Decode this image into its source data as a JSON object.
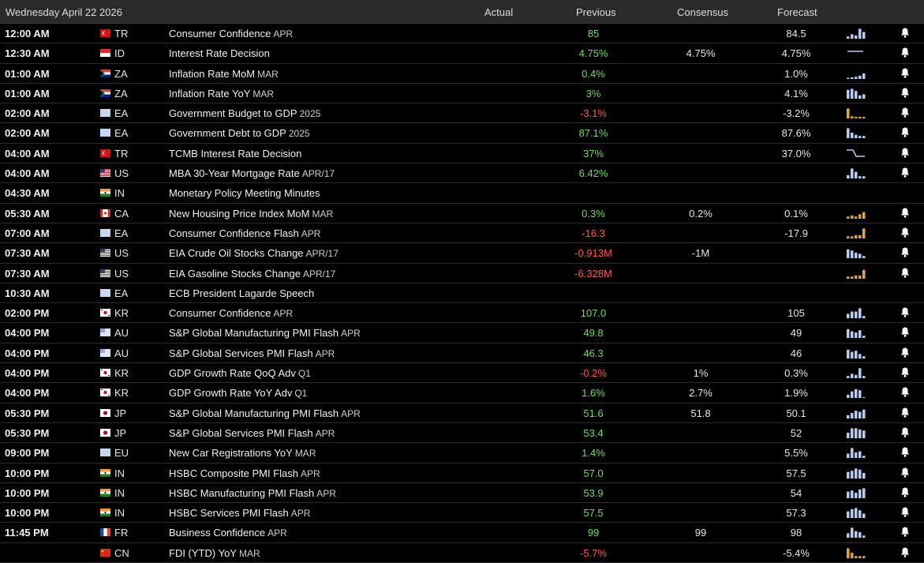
{
  "header": {
    "date": "Wednesday April 22 2026",
    "actual": "Actual",
    "previous": "Previous",
    "consensus": "Consensus",
    "forecast": "Forecast"
  },
  "colors": {
    "positive": "#6fdc5e",
    "negative": "#ff5a4f",
    "spark_blue": "#b7cdf0",
    "spark_gold": "#e5a934"
  },
  "rows": [
    {
      "time": "12:00 AM",
      "country": "TR",
      "flag": "tr",
      "event": "Consumer Confidence",
      "ref": "APR",
      "previous": "85",
      "prev_sign": "pos",
      "consensus": "",
      "forecast": "84.5",
      "spark": "bars-blue",
      "bars": [
        0.2,
        0.4,
        0.3,
        0.9,
        0.6
      ],
      "bell": true
    },
    {
      "time": "12:30 AM",
      "country": "ID",
      "flag": "id",
      "event": "Interest Rate Decision",
      "ref": "",
      "previous": "4.75%",
      "prev_sign": "pos",
      "consensus": "4.75%",
      "forecast": "4.75%",
      "spark": "flat",
      "bars": [],
      "bell": true
    },
    {
      "time": "01:00 AM",
      "country": "ZA",
      "flag": "za",
      "event": "Inflation Rate MoM",
      "ref": "MAR",
      "previous": "0.4%",
      "prev_sign": "pos",
      "consensus": "",
      "forecast": "1.0%",
      "spark": "bars-blue",
      "bars": [
        0.1,
        0.15,
        0.2,
        0.3,
        0.5
      ],
      "bell": true
    },
    {
      "time": "01:00 AM",
      "country": "ZA",
      "flag": "za",
      "event": "Inflation Rate YoY",
      "ref": "MAR",
      "previous": "3%",
      "prev_sign": "pos",
      "consensus": "",
      "forecast": "4.1%",
      "spark": "bars-blue",
      "bars": [
        0.8,
        0.9,
        0.7,
        0.3,
        0.4
      ],
      "bell": true
    },
    {
      "time": "02:00 AM",
      "country": "EA",
      "flag": "eu",
      "event": "Government Budget to GDP",
      "ref": "2025",
      "previous": "-3.1%",
      "prev_sign": "neg",
      "consensus": "",
      "forecast": "-3.2%",
      "spark": "bars-gold",
      "bars": [
        0.9,
        0.2,
        0.15,
        0.15,
        0.15
      ],
      "bell": true
    },
    {
      "time": "02:00 AM",
      "country": "EA",
      "flag": "eu",
      "event": "Government Debt to GDP",
      "ref": "2025",
      "previous": "87.1%",
      "prev_sign": "pos",
      "consensus": "",
      "forecast": "87.6%",
      "spark": "bars-blue",
      "bars": [
        0.9,
        0.5,
        0.3,
        0.2,
        0.2
      ],
      "bell": true
    },
    {
      "time": "04:00 AM",
      "country": "TR",
      "flag": "tr",
      "event": "TCMB Interest Rate Decision",
      "ref": "",
      "previous": "37%",
      "prev_sign": "pos",
      "consensus": "",
      "forecast": "37.0%",
      "spark": "step",
      "bars": [],
      "bell": true
    },
    {
      "time": "04:00 AM",
      "country": "US",
      "flag": "us",
      "event": "MBA 30-Year Mortgage Rate",
      "ref": "APR/17",
      "previous": "6.42%",
      "prev_sign": "pos",
      "consensus": "",
      "forecast": "",
      "spark": "bars-blue",
      "bars": [
        0.3,
        0.9,
        0.6,
        0.2,
        0.2
      ],
      "bell": true
    },
    {
      "time": "04:30 AM",
      "country": "IN",
      "flag": "in",
      "event": "Monetary Policy Meeting Minutes",
      "ref": "",
      "previous": "",
      "prev_sign": "pos",
      "consensus": "",
      "forecast": "",
      "spark": "none",
      "bars": [],
      "bell": false
    },
    {
      "time": "05:30 AM",
      "country": "CA",
      "flag": "ca",
      "event": "New Housing Price Index MoM",
      "ref": "MAR",
      "previous": "0.3%",
      "prev_sign": "pos",
      "consensus": "0.2%",
      "forecast": "0.1%",
      "spark": "bars-gold",
      "bars": [
        0.2,
        0.3,
        0.2,
        0.4,
        0.6
      ],
      "bell": true
    },
    {
      "time": "07:00 AM",
      "country": "EA",
      "flag": "eu",
      "event": "Consumer Confidence Flash",
      "ref": "APR",
      "previous": "-16.3",
      "prev_sign": "neg",
      "consensus": "",
      "forecast": "-17.9",
      "spark": "bars-gold",
      "bars": [
        0.2,
        0.2,
        0.3,
        0.3,
        0.9
      ],
      "bell": true
    },
    {
      "time": "07:30 AM",
      "country": "US",
      "flag": "us",
      "event": "EIA Crude Oil Stocks Change",
      "ref": "APR/17",
      "previous": "-0.913M",
      "prev_sign": "neg",
      "consensus": "-1M",
      "forecast": "",
      "spark": "bars-blue",
      "bars": [
        0.8,
        0.7,
        0.5,
        0.4,
        0.2
      ],
      "bell": true
    },
    {
      "time": "07:30 AM",
      "country": "US",
      "flag": "us",
      "event": "EIA Gasoline Stocks Change",
      "ref": "APR/17",
      "previous": "-6.328M",
      "prev_sign": "neg",
      "consensus": "",
      "forecast": "",
      "spark": "bars-gold",
      "bars": [
        0.2,
        0.2,
        0.3,
        0.3,
        0.8
      ],
      "bell": true
    },
    {
      "time": "10:30 AM",
      "country": "EA",
      "flag": "eu",
      "event": "ECB President Lagarde Speech",
      "ref": "",
      "previous": "",
      "prev_sign": "pos",
      "consensus": "",
      "forecast": "",
      "spark": "none",
      "bars": [],
      "bell": false
    },
    {
      "time": "02:00 PM",
      "country": "KR",
      "flag": "kr",
      "event": "Consumer Confidence",
      "ref": "APR",
      "previous": "107.0",
      "prev_sign": "pos",
      "consensus": "",
      "forecast": "105",
      "spark": "bars-blue",
      "bars": [
        0.4,
        0.6,
        0.6,
        0.9,
        0.2
      ],
      "bell": true
    },
    {
      "time": "04:00 PM",
      "country": "AU",
      "flag": "au",
      "event": "S&P Global Manufacturing PMI Flash",
      "ref": "APR",
      "previous": "49.8",
      "prev_sign": "pos",
      "consensus": "",
      "forecast": "49",
      "spark": "bars-blue",
      "bars": [
        0.8,
        0.6,
        0.5,
        0.7,
        0.2
      ],
      "bell": true
    },
    {
      "time": "04:00 PM",
      "country": "AU",
      "flag": "au",
      "event": "S&P Global Services PMI Flash",
      "ref": "APR",
      "previous": "46.3",
      "prev_sign": "pos",
      "consensus": "",
      "forecast": "46",
      "spark": "bars-blue",
      "bars": [
        0.8,
        0.6,
        0.7,
        0.4,
        0.2
      ],
      "bell": true
    },
    {
      "time": "04:00 PM",
      "country": "KR",
      "flag": "kr",
      "event": "GDP Growth Rate QoQ Adv",
      "ref": "Q1",
      "previous": "-0.2%",
      "prev_sign": "neg",
      "consensus": "1%",
      "forecast": "0.3%",
      "spark": "bars-blue",
      "bars": [
        0.2,
        0.4,
        0.3,
        0.9,
        0.2
      ],
      "bell": true
    },
    {
      "time": "04:00 PM",
      "country": "KR",
      "flag": "kr",
      "event": "GDP Growth Rate YoY Adv",
      "ref": "Q1",
      "previous": "1.6%",
      "prev_sign": "pos",
      "consensus": "2.7%",
      "forecast": "1.9%",
      "spark": "bars-blue",
      "bars": [
        0.3,
        0.6,
        0.8,
        0.7,
        0.0
      ],
      "bell": true
    },
    {
      "time": "05:30 PM",
      "country": "JP",
      "flag": "jp",
      "event": "S&P Global Manufacturing PMI Flash",
      "ref": "APR",
      "previous": "51.6",
      "prev_sign": "pos",
      "consensus": "51.8",
      "forecast": "50.1",
      "spark": "bars-blue",
      "bars": [
        0.3,
        0.5,
        0.7,
        0.6,
        0.8
      ],
      "bell": true
    },
    {
      "time": "05:30 PM",
      "country": "JP",
      "flag": "jp",
      "event": "S&P Global Services PMI Flash",
      "ref": "APR",
      "previous": "53.4",
      "prev_sign": "pos",
      "consensus": "",
      "forecast": "52",
      "spark": "bars-blue",
      "bars": [
        0.5,
        0.9,
        0.9,
        0.8,
        0.7
      ],
      "bell": true
    },
    {
      "time": "09:00 PM",
      "country": "EU",
      "flag": "eu",
      "event": "New Car Registrations YoY",
      "ref": "MAR",
      "previous": "1.4%",
      "prev_sign": "pos",
      "consensus": "",
      "forecast": "5.5%",
      "spark": "bars-blue",
      "bars": [
        0.4,
        0.9,
        0.5,
        0.6,
        0.2
      ],
      "bell": true
    },
    {
      "time": "10:00 PM",
      "country": "IN",
      "flag": "in",
      "event": "HSBC Composite PMI Flash",
      "ref": "APR",
      "previous": "57.0",
      "prev_sign": "pos",
      "consensus": "",
      "forecast": "57.5",
      "spark": "bars-blue",
      "bars": [
        0.6,
        0.7,
        0.9,
        0.8,
        0.5
      ],
      "bell": true
    },
    {
      "time": "10:00 PM",
      "country": "IN",
      "flag": "in",
      "event": "HSBC Manufacturing PMI Flash",
      "ref": "APR",
      "previous": "53.9",
      "prev_sign": "pos",
      "consensus": "",
      "forecast": "54",
      "spark": "bars-blue",
      "bars": [
        0.6,
        0.7,
        0.5,
        0.8,
        0.9
      ],
      "bell": true
    },
    {
      "time": "10:00 PM",
      "country": "IN",
      "flag": "in",
      "event": "HSBC Services PMI Flash",
      "ref": "APR",
      "previous": "57.5",
      "prev_sign": "pos",
      "consensus": "",
      "forecast": "57.3",
      "spark": "bars-blue",
      "bars": [
        0.6,
        0.8,
        0.9,
        0.7,
        0.4
      ],
      "bell": true
    },
    {
      "time": "11:45 PM",
      "country": "FR",
      "flag": "fr",
      "event": "Business Confidence",
      "ref": "APR",
      "previous": "99",
      "prev_sign": "pos",
      "consensus": "99",
      "forecast": "98",
      "spark": "bars-blue",
      "bars": [
        0.4,
        0.9,
        0.6,
        0.5,
        0.2
      ],
      "bell": true
    },
    {
      "time": "",
      "country": "CN",
      "flag": "cn",
      "event": "FDI (YTD) YoY",
      "ref": "MAR",
      "previous": "-5.7%",
      "prev_sign": "neg",
      "consensus": "",
      "forecast": "-5.4%",
      "spark": "bars-gold",
      "bars": [
        0.9,
        0.5,
        0.2,
        0.2,
        0.2
      ],
      "bell": true
    }
  ]
}
